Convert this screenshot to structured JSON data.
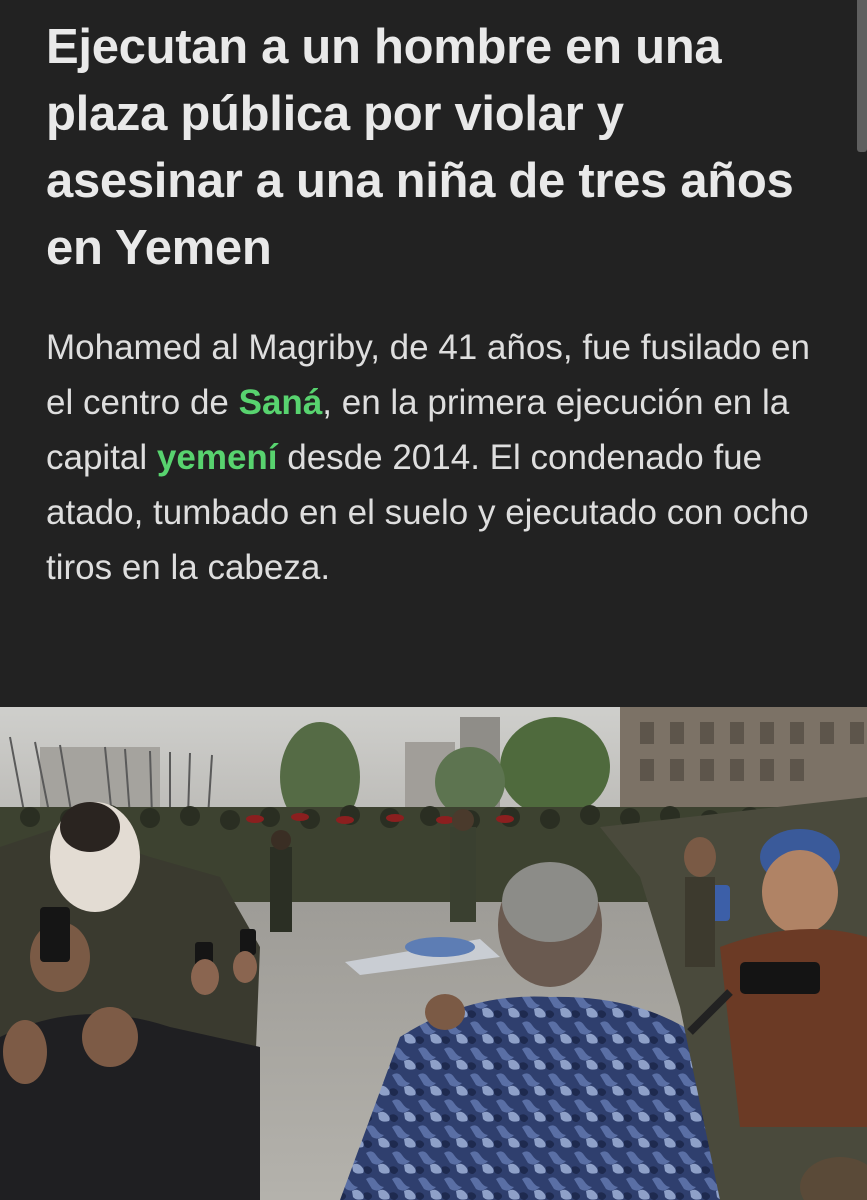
{
  "article": {
    "headline": "Ejecutan a un hombre en una plaza pública por violar y asesinar a una niña de tres años en Yemen",
    "summary": {
      "part1": "Mohamed al Magriby, de 41 años, fue fusilado en el centro de ",
      "link1": "Saná",
      "part2": ", en la primera ejecución en la capital ",
      "link2": "yemení",
      "part3": " desde 2014. El condenado fue atado, tumbado en el suelo y ejecutado con ocho tiros en la cabeza."
    },
    "photo_subject": "crowd-watching-public-execution-photo"
  },
  "colors": {
    "background": "#222222",
    "headline": "#e9e9e9",
    "body_text": "#dedede",
    "link": "#58d36f"
  }
}
